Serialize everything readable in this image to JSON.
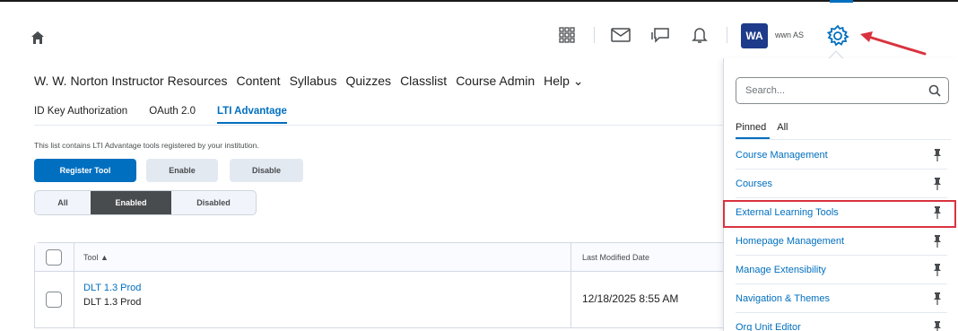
{
  "header": {
    "avatar_initials": "WA",
    "username": "wwn AS"
  },
  "nav": {
    "items": [
      {
        "label": "W. W. Norton Instructor Resources"
      },
      {
        "label": "Content"
      },
      {
        "label": "Syllabus"
      },
      {
        "label": "Quizzes"
      },
      {
        "label": "Classlist"
      },
      {
        "label": "Course Admin"
      },
      {
        "label": "Help ⌄"
      }
    ]
  },
  "subtabs": [
    {
      "label": "ID Key Authorization"
    },
    {
      "label": "OAuth 2.0"
    },
    {
      "label": "LTI Advantage",
      "active": true
    }
  ],
  "description": "This list contains LTI Advantage tools registered by your institution.",
  "buttons": {
    "register": "Register Tool",
    "enable": "Enable",
    "disable": "Disable"
  },
  "filter": {
    "all": "All",
    "enabled": "Enabled",
    "disabled": "Disabled",
    "selected": "Enabled"
  },
  "table": {
    "columns": [
      "Tool ▲",
      "Last Modified Date"
    ],
    "rows": [
      {
        "name": "DLT 1.3 Prod",
        "subname": "DLT 1.3 Prod",
        "date": "12/18/2025 8:55 AM"
      }
    ]
  },
  "panel": {
    "search_placeholder": "Search...",
    "tabs": [
      "Pinned",
      "All"
    ],
    "active_tab": "Pinned",
    "items": [
      {
        "label": "Course Management"
      },
      {
        "label": "Courses"
      },
      {
        "label": "External Learning Tools",
        "highlighted": true
      },
      {
        "label": "Homepage Management"
      },
      {
        "label": "Manage Extensibility"
      },
      {
        "label": "Navigation & Themes"
      },
      {
        "label": "Org Unit Editor"
      }
    ]
  },
  "colors": {
    "accent": "#006fbf",
    "highlight": "#d9333f",
    "avatar_bg": "#1e3a8a"
  },
  "icons": [
    "home-icon",
    "apps-grid-icon",
    "mail-icon",
    "chat-icon",
    "bell-icon",
    "gear-icon",
    "search-icon",
    "pin-icon",
    "arrow-annotation"
  ]
}
